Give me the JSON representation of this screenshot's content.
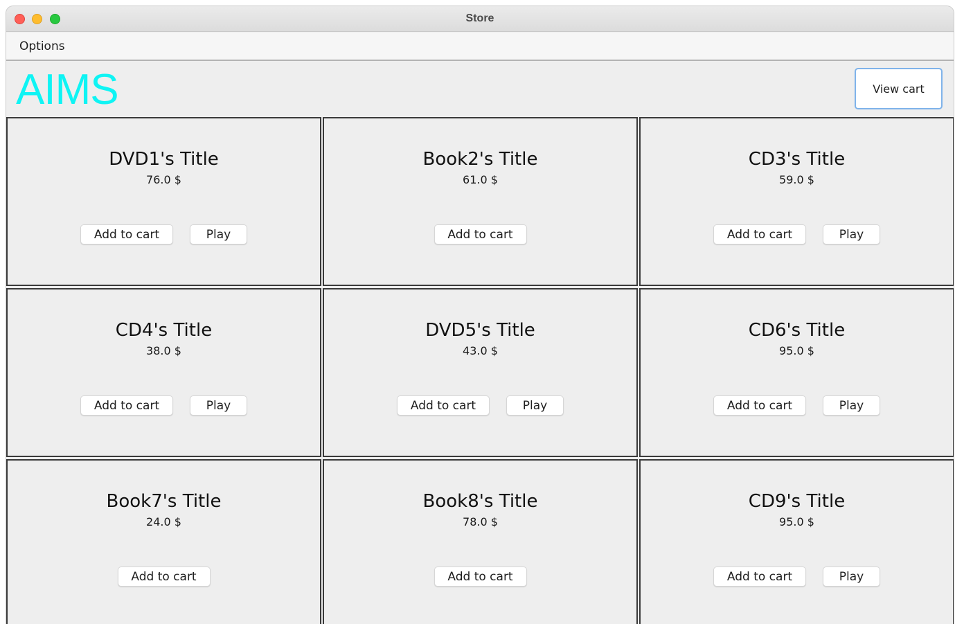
{
  "window": {
    "title": "Store"
  },
  "menu": {
    "options": "Options"
  },
  "header": {
    "logo": "AIMS",
    "view_cart": "View cart"
  },
  "items": [
    {
      "title": "DVD1's Title",
      "price": "76.0 $",
      "add_label": "Add to cart",
      "play_label": "Play"
    },
    {
      "title": "Book2's Title",
      "price": "61.0 $",
      "add_label": "Add to cart",
      "play_label": null
    },
    {
      "title": "CD3's Title",
      "price": "59.0 $",
      "add_label": "Add to cart",
      "play_label": "Play"
    },
    {
      "title": "CD4's Title",
      "price": "38.0 $",
      "add_label": "Add to cart",
      "play_label": "Play"
    },
    {
      "title": "DVD5's Title",
      "price": "43.0 $",
      "add_label": "Add to cart",
      "play_label": "Play"
    },
    {
      "title": "CD6's Title",
      "price": "95.0 $",
      "add_label": "Add to cart",
      "play_label": "Play"
    },
    {
      "title": "Book7's Title",
      "price": "24.0 $",
      "add_label": "Add to cart",
      "play_label": null
    },
    {
      "title": "Book8's Title",
      "price": "78.0 $",
      "add_label": "Add to cart",
      "play_label": null
    },
    {
      "title": "CD9's Title",
      "price": "95.0 $",
      "add_label": "Add to cart",
      "play_label": "Play"
    }
  ],
  "colors": {
    "logo": "#0ff4f4",
    "view_cart_border": "#7fb3ea"
  }
}
